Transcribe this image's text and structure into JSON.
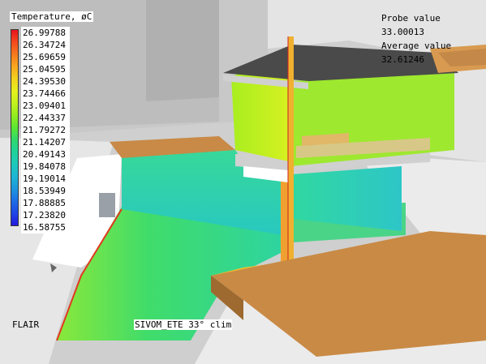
{
  "legend": {
    "title": "Temperature, øC",
    "values": [
      "26.99788",
      "26.34724",
      "25.69659",
      "25.04595",
      "24.39530",
      "23.74466",
      "23.09401",
      "22.44337",
      "21.79272",
      "21.14207",
      "20.49143",
      "19.84078",
      "19.19014",
      "18.53949",
      "17.88885",
      "17.23820",
      "16.58755"
    ],
    "colors": [
      "#e8141e",
      "#f24a1e",
      "#f57a1e",
      "#f8a81e",
      "#f3d21e",
      "#e6f01e",
      "#c2f01e",
      "#94ec1e",
      "#5ae632",
      "#2ed86e",
      "#1ed29a",
      "#1ec8bc",
      "#1eb6d4",
      "#1e96de",
      "#1e6ee6",
      "#1e46e6",
      "#2418e0"
    ]
  },
  "probe": {
    "label": "Probe value",
    "value": "33.00013",
    "average_label": "Average value",
    "average_value": "32.61246"
  },
  "footer": {
    "app_name": "FLAIR",
    "case_name": "SIVOM_ETE 33° clim"
  }
}
